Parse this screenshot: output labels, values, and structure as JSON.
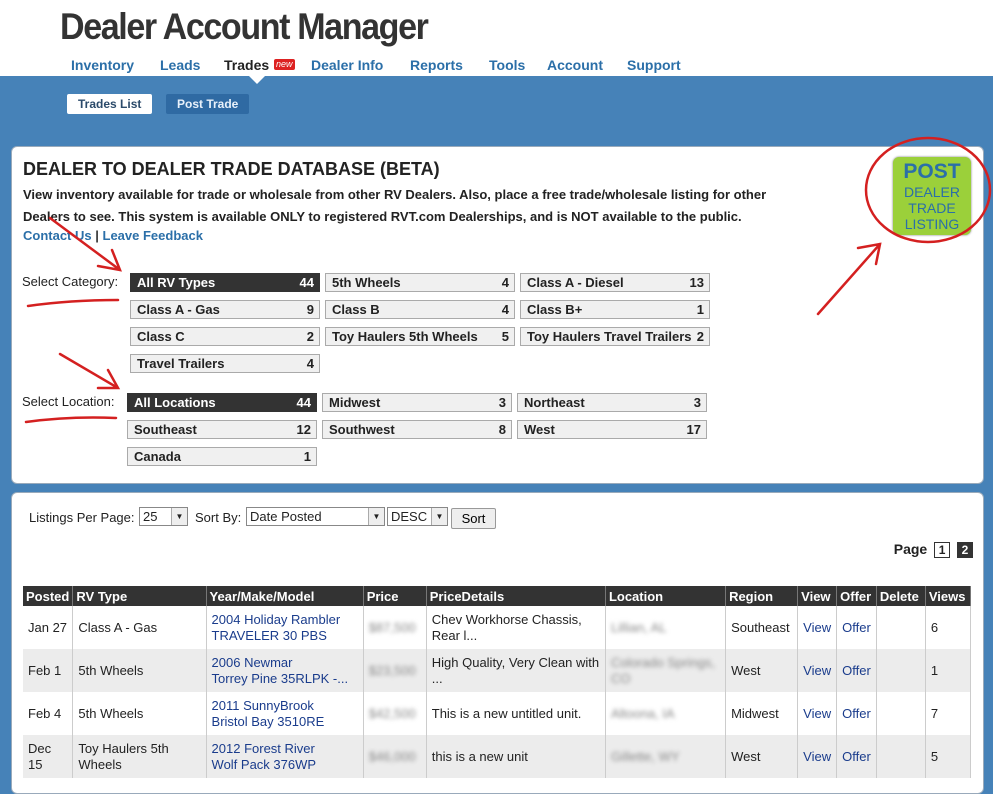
{
  "header": {
    "logo": "Dealer Account Manager",
    "nav": [
      "Inventory",
      "Leads",
      "Trades",
      "Dealer Info",
      "Reports",
      "Tools",
      "Account",
      "Support"
    ],
    "new_badge": "new",
    "subnav": [
      "Trades List",
      "Post Trade"
    ]
  },
  "intro": {
    "title": "DEALER TO DEALER TRADE DATABASE (BETA)",
    "description": "View inventory available for trade or wholesale from other RV Dealers. Also, place a free trade/wholesale listing for other Dealers to see. This system is available ONLY to registered RVT.com Dealerships, and is NOT available to the public.",
    "contact_link": "Contact Us",
    "separator": "|",
    "feedback_link": "Leave Feedback",
    "post_badge": {
      "line1": "POST",
      "line2": "DEALER",
      "line3": "TRADE",
      "line4": "LISTING"
    }
  },
  "filters": {
    "category_label": "Select Category:",
    "categories": [
      {
        "name": "All RV Types",
        "count": "44"
      },
      {
        "name": "5th Wheels",
        "count": "4"
      },
      {
        "name": "Class A - Diesel",
        "count": "13"
      },
      {
        "name": "Class A - Gas",
        "count": "9"
      },
      {
        "name": "Class B",
        "count": "4"
      },
      {
        "name": "Class B+",
        "count": "1"
      },
      {
        "name": "Class C",
        "count": "2"
      },
      {
        "name": "Toy Haulers 5th Wheels",
        "count": "5"
      },
      {
        "name": "Toy Haulers Travel Trailers",
        "count": "2"
      },
      {
        "name": "Travel Trailers",
        "count": "4"
      }
    ],
    "location_label": "Select Location:",
    "locations": [
      {
        "name": "All Locations",
        "count": "44"
      },
      {
        "name": "Midwest",
        "count": "3"
      },
      {
        "name": "Northeast",
        "count": "3"
      },
      {
        "name": "Southeast",
        "count": "12"
      },
      {
        "name": "Southwest",
        "count": "8"
      },
      {
        "name": "West",
        "count": "17"
      },
      {
        "name": "Canada",
        "count": "1"
      }
    ]
  },
  "controls": {
    "per_page_label": "Listings Per Page:",
    "per_page_value": "25",
    "sort_label": "Sort By:",
    "sort_value": "Date Posted",
    "order_value": "DESC",
    "sort_button": "Sort",
    "page_label": "Page",
    "pages": [
      "1",
      "2"
    ]
  },
  "table": {
    "headers": [
      "Posted",
      "RV Type",
      "Year/Make/Model",
      "Price",
      "PriceDetails",
      "Location",
      "Region",
      "View",
      "Offer",
      "Delete",
      "Views"
    ],
    "rows": [
      {
        "posted": "Jan 27",
        "type": "Class A - Gas",
        "model1": "2004 Holiday Rambler",
        "model2": "TRAVELER 30 PBS",
        "price": "$87,500",
        "details": "Chev Workhorse Chassis, Rear l...",
        "location": "Lillian, AL",
        "region": "Southeast",
        "view": "View",
        "offer": "Offer",
        "views": "6"
      },
      {
        "posted": "Feb 1",
        "type": "5th Wheels",
        "model1": "2006 Newmar",
        "model2": "Torrey Pine 35RLPK -...",
        "price": "$23,500",
        "details": "High Quality, Very Clean with ...",
        "location": "Colorado Springs, CO",
        "region": "West",
        "view": "View",
        "offer": "Offer",
        "views": "1"
      },
      {
        "posted": "Feb 4",
        "type": "5th Wheels",
        "model1": "2011 SunnyBrook",
        "model2": "Bristol Bay 3510RE",
        "price": "$42,500",
        "details": "This is a new untitled unit.",
        "location": "Altoona, IA",
        "region": "Midwest",
        "view": "View",
        "offer": "Offer",
        "views": "7"
      },
      {
        "posted": "Dec 15",
        "type": "Toy Haulers 5th Wheels",
        "model1": "2012 Forest River",
        "model2": "Wolf Pack 376WP",
        "price": "$46,000",
        "details": "this is a new unit",
        "location": "Gillette, WY",
        "region": "West",
        "view": "View",
        "offer": "Offer",
        "views": "5"
      }
    ]
  }
}
